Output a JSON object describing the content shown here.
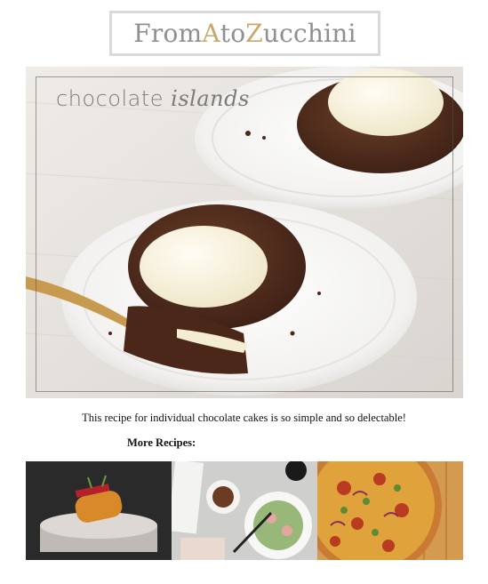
{
  "site": {
    "logo_part1": "From ",
    "logo_a": "A",
    "logo_part2": " to ",
    "logo_z": "Z",
    "logo_part3": "ucchini",
    "accent_color": "#c9a96b"
  },
  "hero": {
    "title_plain": "chocolate ",
    "title_script": "islands"
  },
  "caption": "This recipe for individual chocolate cakes is so simple and so delectable!",
  "more_recipes_label": "More Recipes:",
  "thumbnails": [
    {
      "icon": "plated-dessert-image"
    },
    {
      "icon": "tabletop-meal-image"
    },
    {
      "icon": "pizza-image"
    }
  ]
}
